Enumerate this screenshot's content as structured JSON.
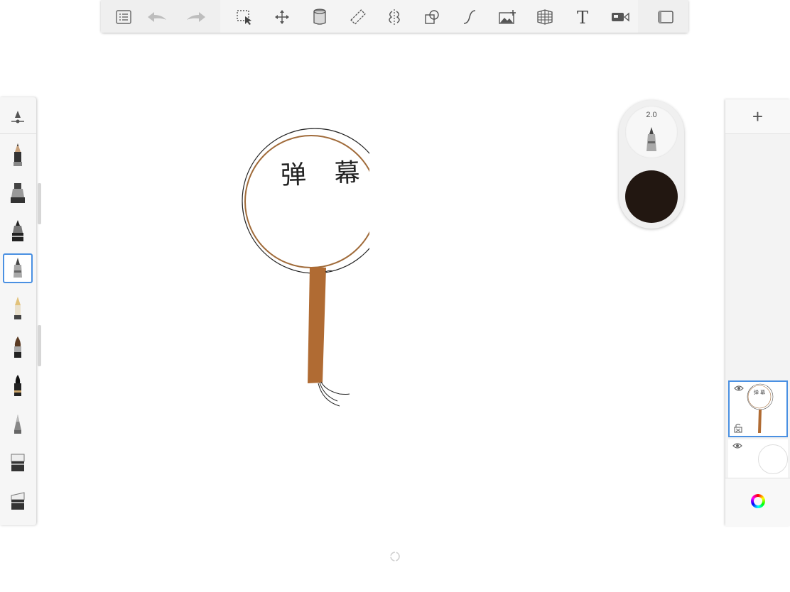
{
  "toolbar": {
    "items": [
      "layers-list",
      "undo",
      "redo",
      "selection",
      "transform",
      "fill",
      "ruler",
      "symmetry",
      "shapes",
      "steady-stroke",
      "import-image",
      "perspective-guide",
      "text",
      "time-lapse",
      "fullscreen"
    ]
  },
  "brush_puck": {
    "size_label": "2.0",
    "color": "#221711"
  },
  "canvas": {
    "handwriting": "弹 幕",
    "handle_color": "#b06b33",
    "rim_color": "#a06b3a"
  },
  "layers": {
    "add_label": "+",
    "items": [
      {
        "name": "layer-1",
        "visible": true,
        "selected": true
      },
      {
        "name": "background",
        "visible": true,
        "selected": false
      }
    ]
  },
  "brushes": [
    "pencil",
    "inking-pen",
    "ballpoint",
    "marker-selected",
    "fountain-pen",
    "paint-brush",
    "ink-brush",
    "airbrush",
    "eraser-soft",
    "eraser-hard"
  ]
}
